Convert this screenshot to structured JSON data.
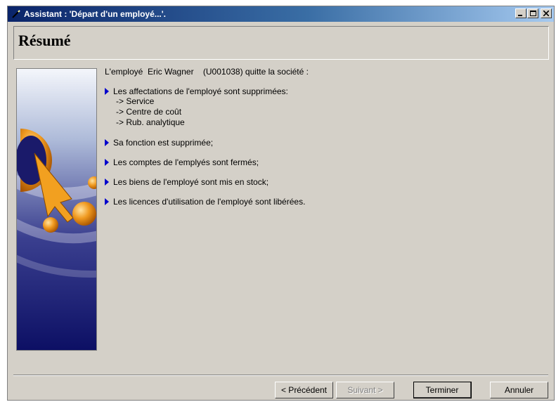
{
  "window": {
    "title": "Assistant : 'Départ d'un employé...'.",
    "minimize_label": "_",
    "maximize_label": "□",
    "close_label": "×"
  },
  "header": {
    "heading": "Résumé"
  },
  "summary": {
    "intro": "L'employé  Eric Wagner    (U001038) quitte la société :",
    "items": [
      {
        "text": "Les affectations de l'employé sont supprimées:",
        "subitems": [
          "-> Service",
          "-> Centre de coût",
          "-> Rub. analytique"
        ]
      },
      {
        "text": "Sa fonction est supprimée;"
      },
      {
        "text": "Les comptes de l'emplyés sont fermés;"
      },
      {
        "text": "Les biens de l'employé sont mis en stock;"
      },
      {
        "text": "Les licences d'utilisation de l'employé sont libérées."
      }
    ]
  },
  "buttons": {
    "previous": "< Précédent",
    "next": "Suivant >",
    "finish": "Terminer",
    "cancel": "Annuler"
  },
  "colors": {
    "bullet_arrow": "#0000cc",
    "titlebar_start": "#0a246a",
    "dialog_face": "#d4d0c8"
  }
}
